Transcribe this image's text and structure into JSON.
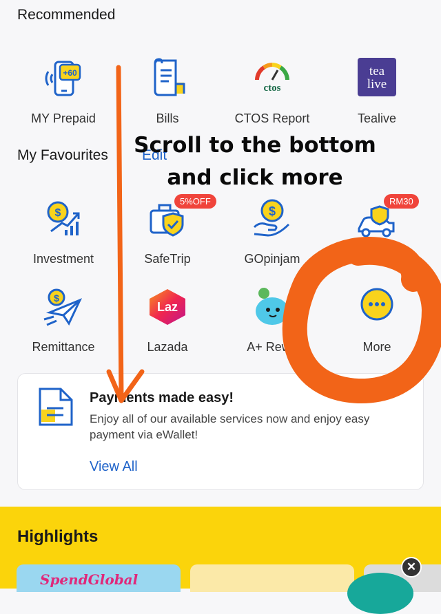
{
  "recommended": {
    "title": "Recommended",
    "items": [
      {
        "label": "MY Prepaid",
        "icon": "phone-topup-icon",
        "icon_text": "+60"
      },
      {
        "label": "Bills",
        "icon": "bill-receipt-icon"
      },
      {
        "label": "CTOS Report",
        "icon": "ctos-logo-icon",
        "icon_text": "ctos"
      },
      {
        "label": "Tealive",
        "icon": "tealive-logo-icon",
        "icon_text_1": "tea",
        "icon_text_2": "live"
      }
    ]
  },
  "favourites": {
    "title": "My Favourites",
    "edit_label": "Edit",
    "items": [
      {
        "label": "Investment",
        "icon": "investment-icon"
      },
      {
        "label": "SafeTrip",
        "icon": "safetrip-shield-icon",
        "badge": "5%OFF"
      },
      {
        "label": "GOpinjam",
        "icon": "gopinjam-loan-icon"
      },
      {
        "label": "",
        "icon": "car-insurance-icon",
        "badge": "RM30"
      },
      {
        "label": "Remittance",
        "icon": "remittance-plane-icon"
      },
      {
        "label": "Lazada",
        "icon": "lazada-logo-icon",
        "icon_text": "Laz"
      },
      {
        "label": "A+ Rewa",
        "icon": "rewards-mascot-icon"
      },
      {
        "label": "More",
        "icon": "more-dots-icon"
      }
    ]
  },
  "payments_card": {
    "title": "Payments made easy!",
    "description": "Enjoy all of our available services now and enjoy easy payment via eWallet!",
    "link": "View All",
    "icon": "document-icon"
  },
  "highlights": {
    "title": "Highlights",
    "banner_text": "SpendGlobal"
  },
  "annotation": {
    "line1": "Scroll to the bottom",
    "line2": "and click more"
  },
  "colors": {
    "accent_blue": "#1f63c9",
    "icon_yellow": "#f9d31c",
    "badge_red": "#f0443b",
    "highlights_yellow": "#fbd40b",
    "annotation_orange": "#f26418"
  }
}
